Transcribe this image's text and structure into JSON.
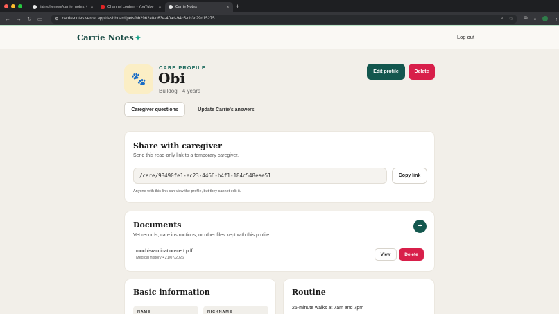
{
  "browser": {
    "tabs": [
      {
        "title": "jiahyphenyee/carrie_notes: C",
        "favicon_color": "#e8e8e8"
      },
      {
        "title": "Channel content - YouTube S",
        "favicon_color": "#e02424"
      },
      {
        "title": "Carrie Notes",
        "favicon_color": "#e8e8e8"
      }
    ],
    "new_tab": "+",
    "url": "carrie-notes.vercel.app/dashboard/pets/bb2962a0-d63e-40ad-94c5-db3c29d15275"
  },
  "header": {
    "logo": "Carrie Notes",
    "logo_mark": "✦",
    "logout": "Log out"
  },
  "profile": {
    "section_label": "CARE PROFILE",
    "name": "Obi",
    "meta": "Bulldog · 4 years",
    "avatar_icon": "paw-icon",
    "edit_label": "Edit profile",
    "delete_label": "Delete"
  },
  "tabs": {
    "caregiver": "Caregiver questions",
    "update": "Update Carrie's answers"
  },
  "share": {
    "title": "Share with caregiver",
    "subtitle": "Send this read-only link to a temporary caregiver.",
    "link": "/care/98490fe1-ec23-4466-b4f1-184c548eae51",
    "copy_label": "Copy link",
    "note": "Anyone with this link can view the profile, but they cannot edit it."
  },
  "documents": {
    "title": "Documents",
    "subtitle": "Vet records, care instructions, or other files kept with this profile.",
    "add_label": "+",
    "items": [
      {
        "name": "mochi-vaccination-cert.pdf",
        "meta": "Medical history • 21/07/2026",
        "view_label": "View",
        "delete_label": "Delete"
      }
    ]
  },
  "basic_info": {
    "title": "Basic information",
    "fields": [
      "NAME",
      "NICKNAME"
    ]
  },
  "routine": {
    "title": "Routine",
    "text": "25-minute walks at 7am and 7pm"
  },
  "colors": {
    "accent": "#13574e",
    "danger": "#d81f4a",
    "background": "#f2efe9"
  }
}
